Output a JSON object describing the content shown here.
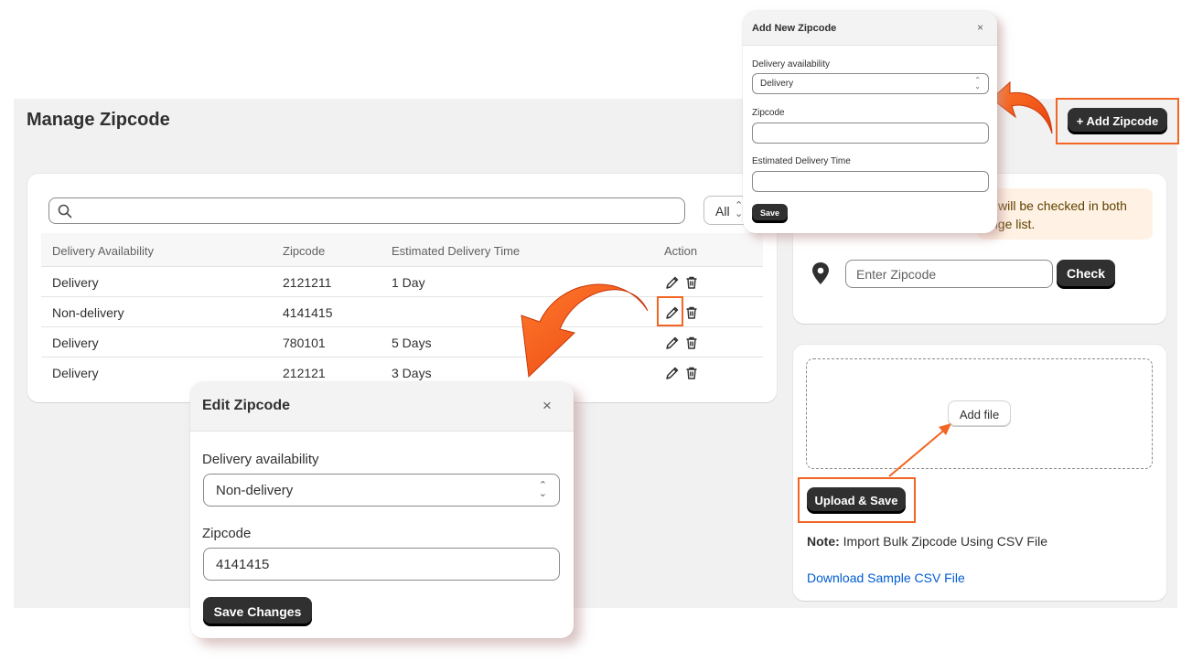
{
  "page": {
    "title": "Manage Zipcode"
  },
  "search": {
    "placeholder": ""
  },
  "filter": {
    "selected": "All"
  },
  "table": {
    "columns": [
      "Delivery Availability",
      "Zipcode",
      "Estimated Delivery Time",
      "Action"
    ],
    "rows": [
      {
        "availability": "Delivery",
        "zipcode": "2121211",
        "time": "1 Day"
      },
      {
        "availability": "Non-delivery",
        "zipcode": "4141415",
        "time": ""
      },
      {
        "availability": "Delivery",
        "zipcode": "780101",
        "time": "5 Days"
      },
      {
        "availability": "Delivery",
        "zipcode": "212121",
        "time": "3 Days"
      }
    ]
  },
  "checker": {
    "banner_line1": "will be checked in both",
    "banner_line2": "nge list.",
    "input_placeholder": "Enter Zipcode",
    "check_label": "Check"
  },
  "upload": {
    "add_file_label": "Add file",
    "upload_label": "Upload & Save",
    "note_label": "Note:",
    "note_text": " Import Bulk Zipcode Using CSV File",
    "sample_link": "Download Sample CSV File"
  },
  "header": {
    "add_zipcode_label": "+ Add Zipcode"
  },
  "add_modal": {
    "title": "Add New Zipcode",
    "close": "×",
    "availability_label": "Delivery availability",
    "availability_value": "Delivery",
    "zipcode_label": "Zipcode",
    "zipcode_value": "",
    "time_label": "Estimated Delivery Time",
    "time_value": "",
    "save_label": "Save"
  },
  "edit_modal": {
    "title": "Edit Zipcode",
    "close": "×",
    "availability_label": "Delivery availability",
    "availability_value": "Non-delivery",
    "zipcode_label": "Zipcode",
    "zipcode_value": "4141415",
    "save_label": "Save Changes"
  },
  "icons": {
    "search": "search-icon",
    "edit": "pencil-icon",
    "delete": "trash-icon",
    "location": "location-pin-icon",
    "select": "chevron-up-down-icon",
    "close": "close-icon"
  },
  "colors": {
    "accent": "#f26522",
    "primary_button": "#303030",
    "link": "#005bd3",
    "banner_bg": "#fff1e3",
    "page_bg": "#f1f1f1"
  }
}
